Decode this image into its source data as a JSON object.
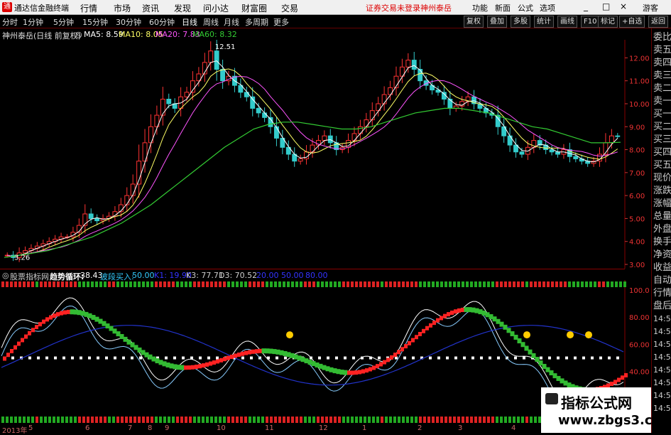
{
  "app": {
    "title": "通达信金融终端",
    "menus": [
      "行情",
      "市场",
      "资讯",
      "发现",
      "问小达",
      "财富圈",
      "交易"
    ],
    "notice": "证券交易未登录",
    "stock_name_top": "神州泰岳",
    "right_menus": [
      "功能",
      "新面",
      "公式",
      "选项"
    ],
    "guest": "游客",
    "window_buttons": [
      "_",
      "□",
      "×"
    ]
  },
  "toolbar": {
    "periods": [
      "分时",
      "1分钟",
      "5分钟",
      "15分钟",
      "30分钟",
      "60分钟",
      "日线",
      "周线",
      "月线",
      "多周期",
      "更多"
    ],
    "active_period": "日线",
    "right_buttons": [
      "复权",
      "叠加",
      "多股",
      "统计",
      "画线",
      "F10",
      "标记",
      "+自选",
      "返回"
    ]
  },
  "main_chart": {
    "title": "神州泰岳(日线 前复权)",
    "ma5": "MA5: 8.59",
    "ma10": "MA10: 8.05",
    "ma20": "MA20: 7.83",
    "ma60": "MA60: 8.32",
    "high_label": "12.51",
    "low_label": "3.26",
    "y_ticks": [
      "12.00",
      "11.00",
      "10.00",
      "9.00",
      "8.00",
      "7.00",
      "6.00",
      "5.00",
      "4.00",
      "3.00"
    ],
    "colors": {
      "up": "#ff3333",
      "down": "#33cccc",
      "ma5": "#ffffff",
      "ma10": "#ffff66",
      "ma20": "#ff55ff",
      "ma60": "#33cc33"
    }
  },
  "indicator": {
    "source": "股票指标网",
    "name": "趋势循环:",
    "value1": "38.43",
    "value2_label": "波段买入:",
    "value2": "50.00",
    "k1": "K1: 19.90",
    "k3": "K3: 77.71",
    "d3": "D3: 70.52",
    "v20": "20.00",
    "v50": "50.00",
    "v80": "80.00",
    "y_ticks": [
      "100.0",
      "80.00",
      "60.00",
      "40.00",
      "20.00"
    ]
  },
  "dates": [
    "2013年",
    "5",
    "6",
    "7",
    "8",
    "9",
    "10",
    "11",
    "12",
    "1",
    "2",
    "3",
    "4"
  ],
  "sidepanel": {
    "items": [
      "委比",
      "卖五",
      "卖四",
      "卖三",
      "卖二",
      "卖一",
      "买一",
      "买二",
      "买三",
      "买四",
      "买五",
      "现价",
      "涨跌",
      "涨幅",
      "总量",
      "外盘",
      "换手",
      "净资",
      "收益"
    ],
    "items2": [
      "自动",
      "行情",
      "盘后",
      "14:56",
      "14:56",
      "14:56",
      "14:56",
      "14:56",
      "14:56",
      "14:56",
      "14:56"
    ]
  },
  "watermark": {
    "line1": "指标公式网",
    "line2": "www.zbgs3.com"
  },
  "chart_data": {
    "type": "candlestick",
    "title": "神州泰岳(日线 前复权)",
    "closes": [
      3.4,
      3.3,
      3.5,
      3.6,
      3.7,
      3.8,
      3.9,
      4.0,
      4.1,
      4.2,
      4.2,
      4.4,
      4.7,
      5.2,
      5.0,
      4.9,
      5.0,
      5.1,
      5.3,
      5.6,
      6.0,
      6.5,
      7.5,
      8.3,
      9.0,
      9.5,
      10.2,
      10.0,
      9.8,
      10.3,
      10.5,
      11.0,
      11.3,
      11.8,
      12.3,
      11.5,
      11.0,
      11.2,
      10.8,
      10.5,
      10.3,
      9.8,
      9.6,
      9.4,
      9.0,
      8.5,
      8.1,
      7.8,
      7.5,
      7.6,
      7.9,
      8.2,
      8.4,
      8.6,
      8.3,
      8.0,
      8.1,
      8.4,
      8.7,
      9.0,
      9.3,
      9.7,
      10.0,
      10.4,
      10.7,
      11.2,
      11.6,
      11.9,
      11.5,
      11.0,
      10.8,
      10.6,
      10.5,
      10.2,
      9.8,
      9.9,
      10.1,
      10.3,
      10.0,
      9.8,
      9.6,
      9.5,
      9.0,
      8.6,
      8.2,
      7.9,
      7.8,
      8.1,
      8.4,
      8.2,
      8.0,
      7.9,
      7.8,
      8.0,
      7.7,
      7.6,
      7.5,
      7.4,
      7.5,
      7.8,
      8.3,
      8.6,
      8.59
    ],
    "ylim": [
      3.0,
      12.6
    ],
    "ma60_closes": [
      3.3,
      3.4,
      3.5,
      3.6,
      3.8,
      4.0,
      4.2,
      4.5,
      4.8,
      5.2,
      5.6,
      6.1,
      6.6,
      7.1,
      7.6,
      8.1,
      8.5,
      8.9,
      9.1,
      9.2,
      9.2,
      9.1,
      9.0,
      8.9,
      8.9,
      9.0,
      9.2,
      9.4,
      9.6,
      9.7,
      9.8,
      9.8,
      9.7,
      9.6,
      9.4,
      9.2,
      9.0,
      8.9,
      8.7,
      8.5,
      8.3,
      8.3,
      8.32
    ],
    "indicator_ylim": [
      10,
      100
    ]
  }
}
